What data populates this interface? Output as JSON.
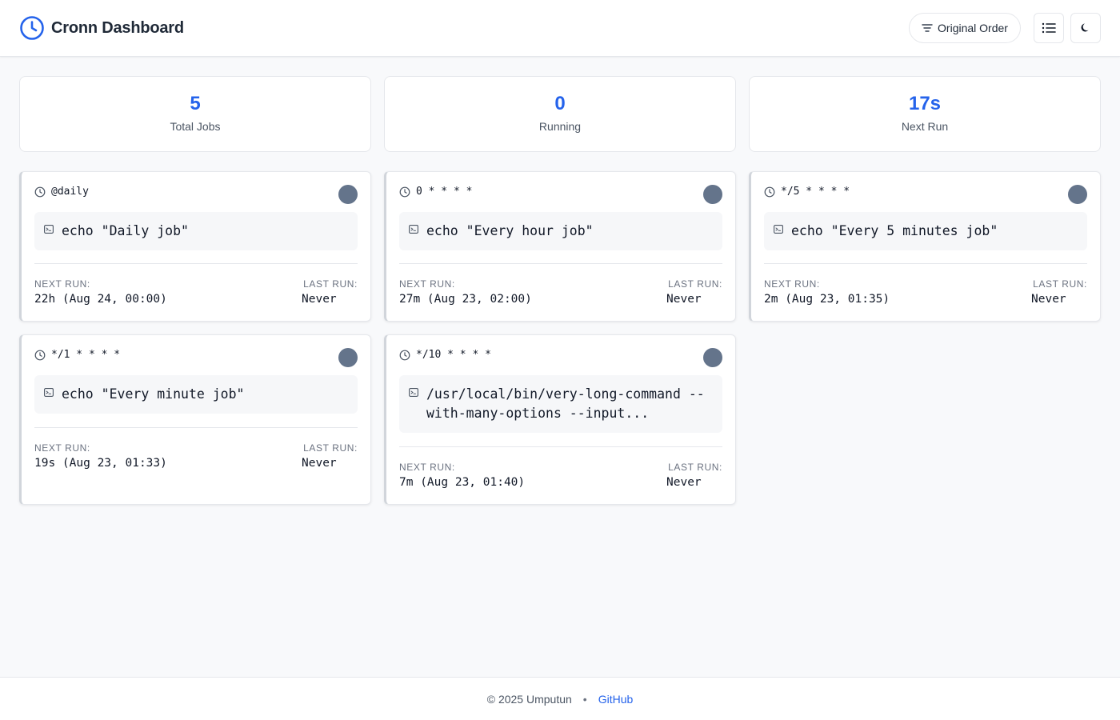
{
  "header": {
    "title": "Cronn Dashboard",
    "sort_label": "Original Order",
    "accent": "#2563eb",
    "icons": {
      "brand": "clock-icon",
      "sort": "sort-lines-icon",
      "view": "list-view-icon",
      "theme": "moon-icon"
    }
  },
  "stats": [
    {
      "value": "5",
      "label": "Total Jobs"
    },
    {
      "value": "0",
      "label": "Running"
    },
    {
      "value": "17s",
      "label": "Next Run"
    }
  ],
  "labels": {
    "next_run": "NEXT RUN:",
    "last_run": "LAST RUN:"
  },
  "jobs": [
    {
      "schedule": "@daily",
      "command": "echo \"Daily job\"",
      "next_run": "22h (Aug 24, 00:00)",
      "last_run": "Never"
    },
    {
      "schedule": "0 * * * *",
      "command": "echo \"Every hour job\"",
      "next_run": "27m (Aug 23, 02:00)",
      "last_run": "Never"
    },
    {
      "schedule": "*/5 * * * *",
      "command": "echo \"Every 5 minutes job\"",
      "next_run": "2m (Aug 23, 01:35)",
      "last_run": "Never"
    },
    {
      "schedule": "*/1 * * * *",
      "command": "echo \"Every minute job\"",
      "next_run": "19s (Aug 23, 01:33)",
      "last_run": "Never"
    },
    {
      "schedule": "*/10 * * * *",
      "command": "/usr/local/bin/very-long-command --with-many-options --input...",
      "next_run": "7m (Aug 23, 01:40)",
      "last_run": "Never"
    }
  ],
  "footer": {
    "copyright": "© 2025 Umputun",
    "separator": "•",
    "link": "GitHub"
  }
}
